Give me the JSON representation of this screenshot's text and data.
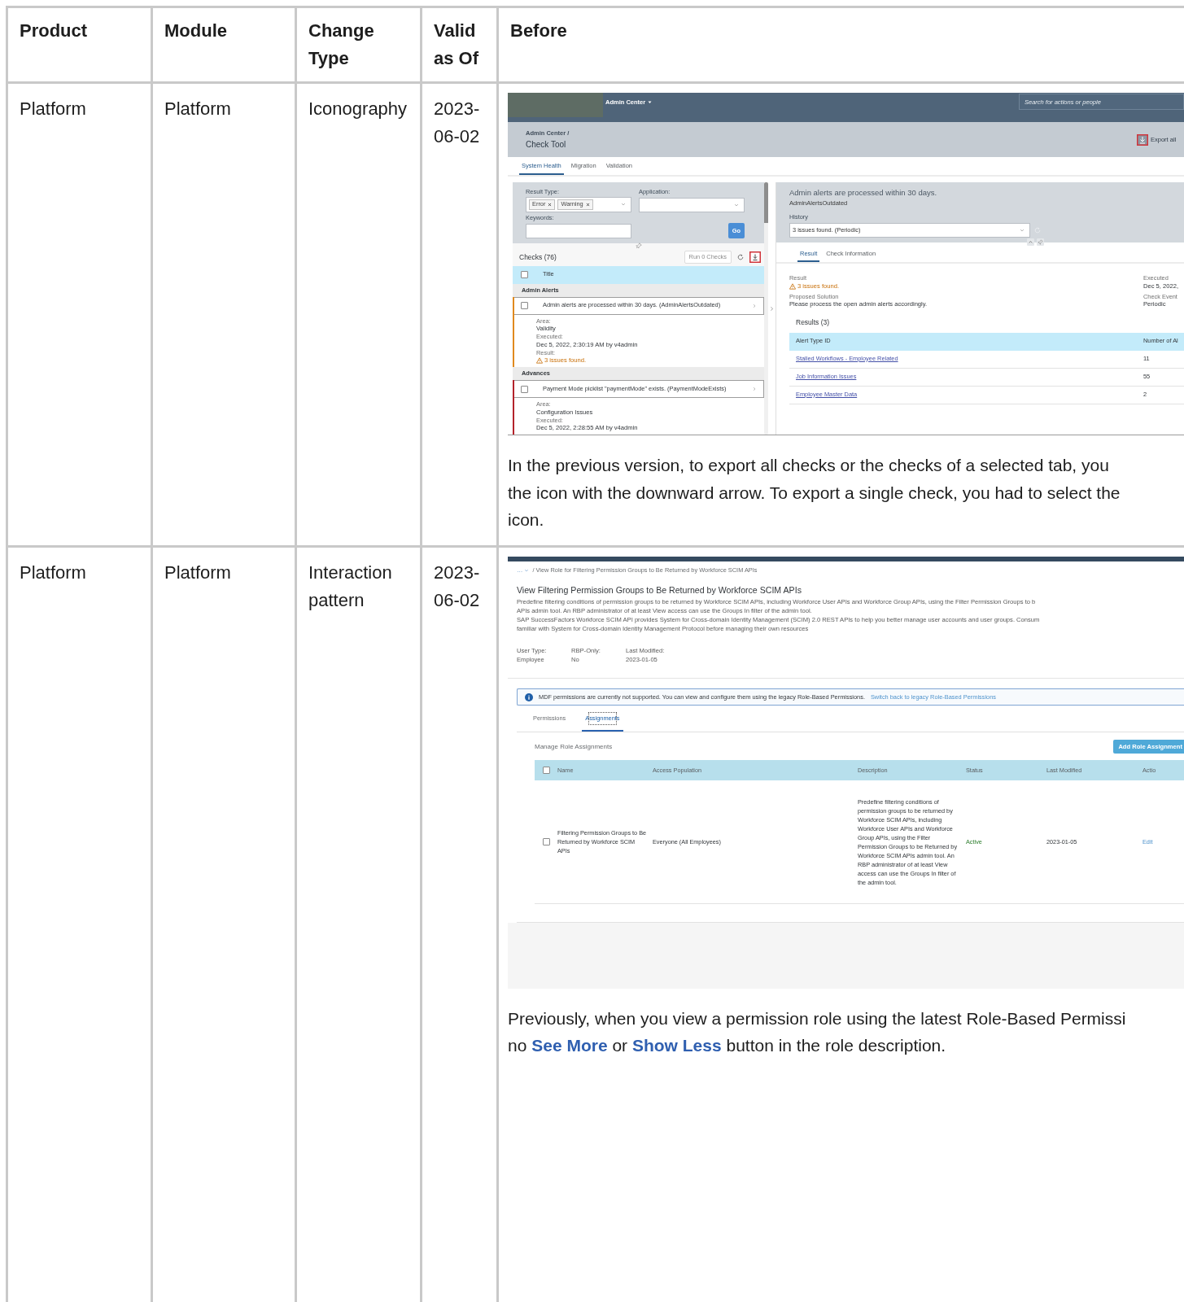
{
  "table": {
    "columns": [
      "Product",
      "Module",
      "Change Type",
      "Valid as Of",
      "Before"
    ],
    "rows": [
      {
        "product": "Platform",
        "module": "Platform",
        "change_type": "Iconography",
        "valid_as_of": "2023-06-02",
        "before": {
          "kind": "check_tool",
          "screenshot": {
            "shell": {
              "menu": "Admin Center",
              "search": {
                "placeholder": "Search for actions or people"
              }
            },
            "header": {
              "breadcrumb": "Admin Center /",
              "title": "Check Tool",
              "export_label": "Export all"
            },
            "tabs": [
              {
                "label": "System Health",
                "selected": true
              },
              {
                "label": "Migration",
                "selected": false
              },
              {
                "label": "Validation",
                "selected": false
              }
            ],
            "filters": {
              "result_type_label": "Result Type:",
              "tokens": [
                "Error",
                "Warning"
              ],
              "application_label": "Application:",
              "keywords_label": "Keywords:",
              "go": "Go"
            },
            "checks": {
              "title": "Checks (76)",
              "select_all": {
                "checked": false
              },
              "run_button": {
                "label": "Run 0 Checks",
                "disabled": true
              },
              "column": "Title",
              "groups": [
                {
                  "name": "Admin Alerts",
                  "items": [
                    {
                      "title": "Admin alerts are processed within 30 days. (AdminAlertsOutdated)",
                      "checked": false,
                      "color": "#e08a1e",
                      "details": [
                        {
                          "label": "Area:",
                          "value": "Validity",
                          "kind": "text"
                        },
                        {
                          "label": "Executed:",
                          "value": "Dec 5, 2022, 2:30:19 AM by v4admin",
                          "kind": "text"
                        },
                        {
                          "label": "Result:",
                          "value": "3 issues found.",
                          "kind": "warning"
                        }
                      ]
                    }
                  ]
                },
                {
                  "name": "Advances",
                  "items": [
                    {
                      "title": "Payment Mode picklist \"paymentMode\" exists. (PaymentModeExists)",
                      "checked": false,
                      "color": "#b3232b",
                      "details": [
                        {
                          "label": "Area:",
                          "value": "Configuration Issues",
                          "kind": "text"
                        },
                        {
                          "label": "Executed:",
                          "value": "Dec 5, 2022, 2:28:55 AM by v4admin",
                          "kind": "text"
                        }
                      ]
                    }
                  ]
                }
              ]
            },
            "detail": {
              "title": "Admin alerts are processed within 30 days.",
              "subtitle": "AdminAlertsOutdated",
              "history_label": "History",
              "history_value": "3 issues found. (Periodic)",
              "tabs": [
                {
                  "label": "Result",
                  "selected": true
                },
                {
                  "label": "Check Information",
                  "selected": false
                }
              ],
              "facts_left": [
                {
                  "label": "Result",
                  "value": "3 issues found.",
                  "kind": "warning"
                },
                {
                  "label": "Proposed Solution",
                  "value": "Please process the open admin alerts accordingly.",
                  "kind": "text"
                }
              ],
              "facts_right": [
                {
                  "label": "Executed",
                  "value": "Dec 5, 2022,",
                  "kind": "text"
                },
                {
                  "label": "Check Event",
                  "value": "Periodic",
                  "kind": "text"
                }
              ],
              "results_title": "Results (3)",
              "columns": [
                "Alert Type ID",
                "Number of Al"
              ],
              "rows": [
                {
                  "alert_type": "Stalled Workflows - Employee Related",
                  "count": "11"
                },
                {
                  "alert_type": "Job Information Issues",
                  "count": "55"
                },
                {
                  "alert_type": "Employee Master Data",
                  "count": "2"
                }
              ]
            }
          },
          "description": [
            [
              {
                "text": "In the previous version, to export all checks or the checks of a selected tab, you",
                "link": false
              }
            ],
            [
              {
                "text": "the icon with the downward arrow. To export a single check, you had to select the",
                "link": false
              }
            ],
            [
              {
                "text": "icon.",
                "link": false
              }
            ]
          ]
        }
      },
      {
        "product": "Platform",
        "module": "Platform",
        "change_type": "Interaction pattern",
        "valid_as_of": "2023-06-02",
        "before": {
          "kind": "role_view",
          "screenshot": {
            "breadcrumb": {
              "overflow": "…",
              "current": "/ View Role for Filtering Permission Groups to Be Returned by Workforce SCIM APIs"
            },
            "title": "View Filtering Permission Groups to Be Returned by Workforce SCIM APIs",
            "description_lines": [
              "Predefine filtering conditions of permission groups to be returned by Workforce SCIM APIs, including Workforce User APIs and Workforce Group APIs, using the Filter Permission Groups to b",
              "APIs admin tool. An RBP administrator of at least View access can use the Groups In filter of the admin tool.",
              "SAP SuccessFactors Workforce SCIM API provides System for Cross-domain Identity Management (SCIM) 2.0 REST APIs to help you better manage user accounts and user groups. Consum",
              "familiar with System for Cross-domain Identity Management Protocol before managing their own resources"
            ],
            "meta": [
              {
                "label": "User Type:",
                "value": "Employee"
              },
              {
                "label": "RBP-Only:",
                "value": "No"
              },
              {
                "label": "Last Modified:",
                "value": "2023-01-05"
              }
            ],
            "notice": {
              "text": "MDF permissions are currently not supported. You can view and configure them using the legacy Role-Based Permissions.",
              "link": "Switch back to legacy Role-Based Permissions"
            },
            "tabs": [
              {
                "label": "Permissions",
                "selected": false
              },
              {
                "label": "Assignments",
                "selected": true
              }
            ],
            "section_title": "Manage Role Assignments",
            "add_button": "Add Role Assignment",
            "select_all": {
              "checked": false
            },
            "columns": [
              "Name",
              "Access Population",
              "Description",
              "Status",
              "Last Modified",
              "Actio"
            ],
            "rows": [
              {
                "name": "Filtering Permission Groups to Be Returned by Workforce SCIM APIs",
                "checked": false,
                "access_population": "Everyone (All Employees)",
                "description": "Predefine filtering conditions of permission groups to be returned by Workforce SCIM APIs, including Workforce User APIs and Workforce Group APIs, using the Filter Permission Groups to be Returned by Workforce SCIM APIs admin tool. An RBP administrator of at least View access can use the Groups In filter of the admin tool.",
                "status": "Active",
                "last_modified": "2023-01-05",
                "action": "Edit"
              }
            ]
          },
          "description": [
            [
              {
                "text": "Previously, when you view a permission role using the latest Role-Based Permissi",
                "link": false
              }
            ],
            [
              {
                "text": "no ",
                "link": false
              },
              {
                "text": "See More",
                "link": true
              },
              {
                "text": " or ",
                "link": false
              },
              {
                "text": "Show Less",
                "link": true
              },
              {
                "text": " button in the role description.",
                "link": false
              }
            ]
          ]
        }
      }
    ]
  }
}
